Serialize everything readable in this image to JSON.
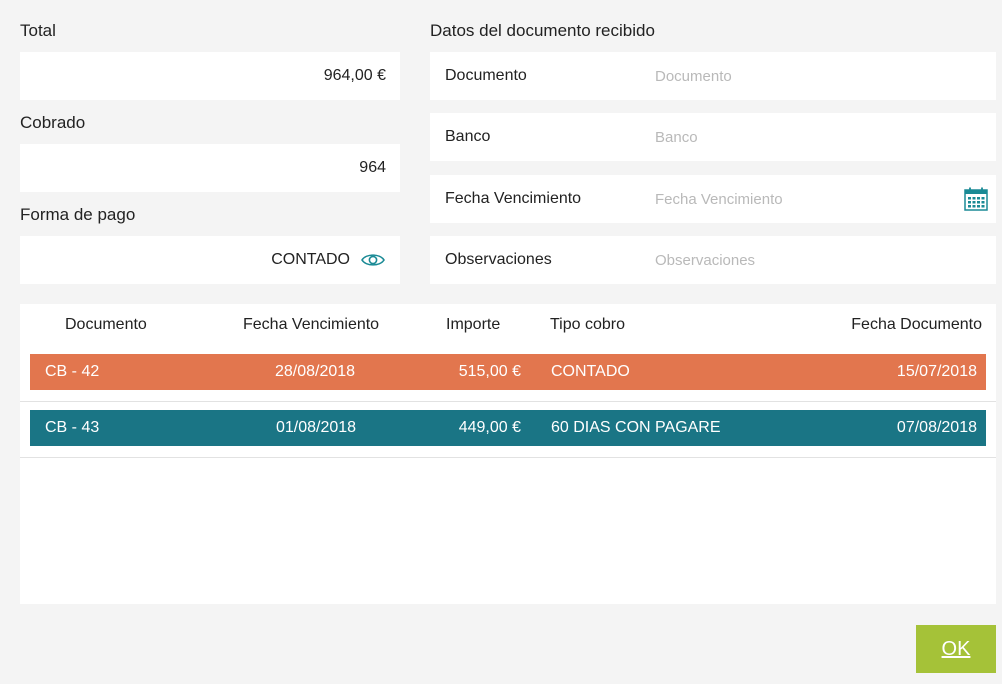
{
  "left": {
    "total_label": "Total",
    "total_value": "964,00 €",
    "cobrado_label": "Cobrado",
    "cobrado_value": "964",
    "forma_pago_label": "Forma de pago",
    "forma_pago_value": "CONTADO",
    "forma_pago_icon": "eye-icon"
  },
  "received_doc": {
    "title": "Datos del documento recibido",
    "fields": [
      {
        "label": "Documento",
        "placeholder": "Documento",
        "value": ""
      },
      {
        "label": "Banco",
        "placeholder": "Banco",
        "value": ""
      },
      {
        "label": "Fecha Vencimiento",
        "placeholder": "Fecha Vencimiento",
        "value": "",
        "icon": "calendar-icon"
      },
      {
        "label": "Observaciones",
        "placeholder": "Observaciones",
        "value": ""
      }
    ]
  },
  "table": {
    "headers": [
      "Documento",
      "Fecha Vencimiento",
      "Importe",
      "Tipo cobro",
      "Fecha Documento"
    ],
    "rows": [
      {
        "documento": "CB - 42",
        "fecha_vencimiento": "28/08/2018",
        "importe": "515,00 €",
        "tipo_cobro": "CONTADO",
        "fecha_documento": "15/07/2018",
        "color": "#e2764e"
      },
      {
        "documento": "CB - 43",
        "fecha_vencimiento": "01/08/2018",
        "importe": "449,00 €",
        "tipo_cobro": "60 DIAS CON PAGARE",
        "fecha_documento": "07/08/2018",
        "color": "#1a7585"
      }
    ]
  },
  "footer": {
    "ok_label": "OK"
  },
  "colors": {
    "accent_orange": "#e2764e",
    "accent_teal": "#1a7585",
    "ok_green": "#a5c238"
  }
}
